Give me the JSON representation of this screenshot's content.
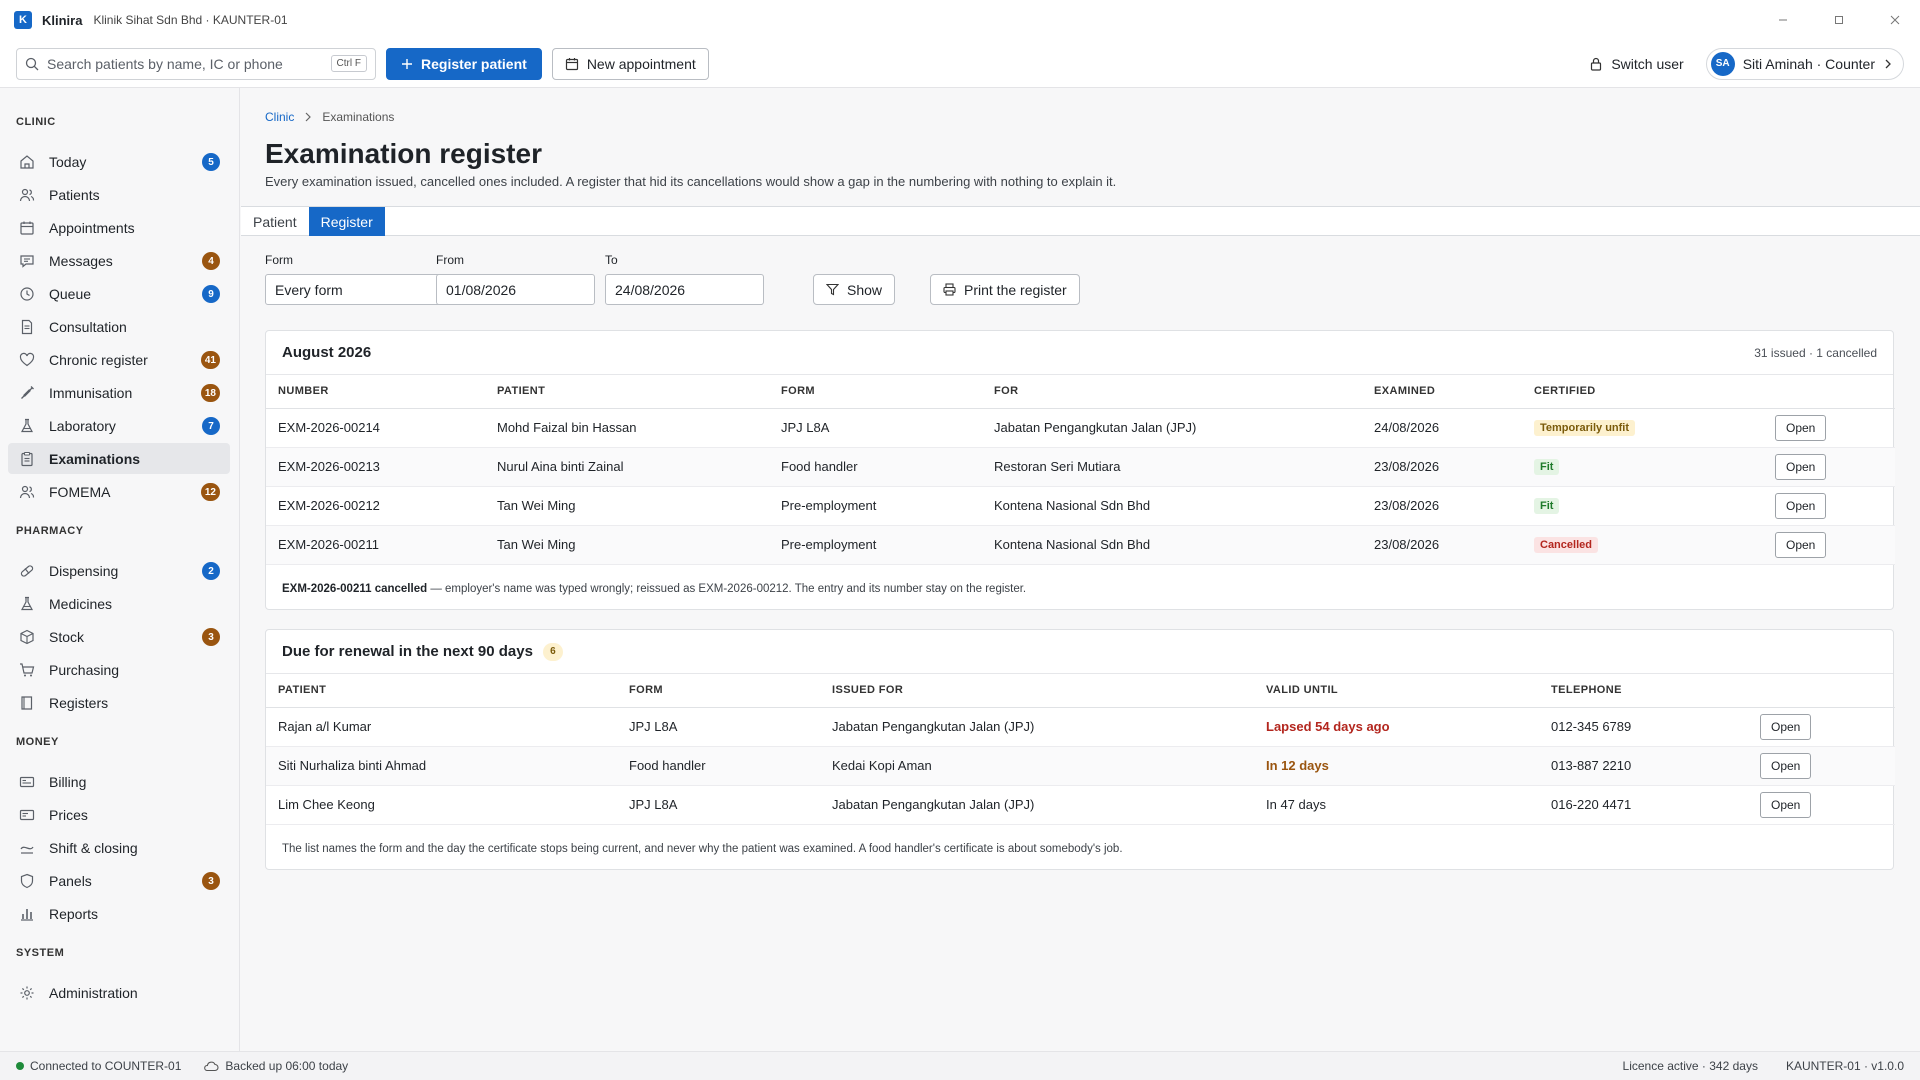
{
  "titlebar": {
    "logo_letter": "K",
    "app_name": "Klinira",
    "subtitle": "Klinik Sihat Sdn Bhd · KAUNTER-01"
  },
  "toolbar": {
    "search_placeholder": "Search patients by name, IC or phone",
    "search_shortcut": "Ctrl F",
    "register_patient": "Register patient",
    "new_appointment": "New appointment",
    "switch_user": "Switch user",
    "user_initials": "SA",
    "user_label": "Siti Aminah · Counter"
  },
  "sidebar": {
    "clinic_head": "CLINIC",
    "clinic": [
      {
        "label": "Today",
        "badge": "5",
        "icon": "home-icon"
      },
      {
        "label": "Patients",
        "badge": "",
        "icon": "users-icon"
      },
      {
        "label": "Appointments",
        "badge": "",
        "icon": "calendar-icon"
      },
      {
        "label": "Messages",
        "badge": "4",
        "icon": "message-icon"
      },
      {
        "label": "Queue",
        "badge": "9",
        "icon": "clock-icon"
      },
      {
        "label": "Consultation",
        "badge": "",
        "icon": "document-icon"
      },
      {
        "label": "Chronic register",
        "badge": "41",
        "icon": "heart-icon"
      },
      {
        "label": "Immunisation",
        "badge": "18",
        "icon": "syringe-icon"
      },
      {
        "label": "Laboratory",
        "badge": "7",
        "icon": "flask-icon"
      },
      {
        "label": "Examinations",
        "badge": "",
        "icon": "clipboard-icon"
      },
      {
        "label": "FOMEMA",
        "badge": "12",
        "icon": "users-icon"
      }
    ],
    "pharmacy_head": "PHARMACY",
    "pharmacy": [
      {
        "label": "Dispensing",
        "badge": "2",
        "icon": "pill-icon"
      },
      {
        "label": "Medicines",
        "badge": "",
        "icon": "flask-icon"
      },
      {
        "label": "Stock",
        "badge": "3",
        "icon": "box-icon"
      },
      {
        "label": "Purchasing",
        "badge": "",
        "icon": "cart-icon"
      },
      {
        "label": "Registers",
        "badge": "",
        "icon": "book-icon"
      }
    ],
    "money_head": "MONEY",
    "money": [
      {
        "label": "Billing",
        "badge": "",
        "icon": "billing-icon"
      },
      {
        "label": "Prices",
        "badge": "",
        "icon": "tag-icon"
      },
      {
        "label": "Shift & closing",
        "badge": "",
        "icon": "cash-icon"
      },
      {
        "label": "Panels",
        "badge": "3",
        "icon": "shield-icon"
      },
      {
        "label": "Reports",
        "badge": "",
        "icon": "chart-icon"
      }
    ],
    "system_head": "SYSTEM",
    "system": [
      {
        "label": "Administration",
        "badge": "",
        "icon": "gear-icon"
      }
    ]
  },
  "main": {
    "breadcrumb_root": "Clinic",
    "breadcrumb_current": "Examinations",
    "title": "Examination register",
    "description": "Every examination issued, cancelled ones included. A register that hid its cancellations would show a gap in the numbering with nothing to explain it.",
    "tabs": [
      "Patient",
      "Register"
    ],
    "filters": {
      "form_label": "Form",
      "form_value": "Every form",
      "from_label": "From",
      "from_value": "01/08/2026",
      "to_label": "To",
      "to_value": "24/08/2026",
      "show": "Show",
      "print": "Print the register"
    },
    "register": {
      "title": "August 2026",
      "meta": "31 issued · 1 cancelled",
      "headers": [
        "NUMBER",
        "PATIENT",
        "FORM",
        "FOR",
        "EXAMINED",
        "CERTIFIED"
      ],
      "open_label": "Open",
      "rows": [
        {
          "number": "EXM-2026-00214",
          "patient": "Mohd Faizal bin Hassan",
          "form": "JPJ L8A",
          "for": "Jabatan Pengangkutan Jalan (JPJ)",
          "examined": "24/08/2026",
          "certified": "Temporarily unfit",
          "status": "amber"
        },
        {
          "number": "EXM-2026-00213",
          "patient": "Nurul Aina binti Zainal",
          "form": "Food handler",
          "for": "Restoran Seri Mutiara",
          "examined": "23/08/2026",
          "certified": "Fit",
          "status": "green"
        },
        {
          "number": "EXM-2026-00212",
          "patient": "Tan Wei Ming",
          "form": "Pre-employment",
          "for": "Kontena Nasional Sdn Bhd",
          "examined": "23/08/2026",
          "certified": "Fit",
          "status": "green"
        },
        {
          "number": "EXM-2026-00211",
          "patient": "Tan Wei Ming",
          "form": "Pre-employment",
          "for": "Kontena Nasional Sdn Bhd",
          "examined": "23/08/2026",
          "certified": "Cancelled",
          "status": "red"
        }
      ],
      "note_bold": "EXM-2026-00211 cancelled",
      "note_rest": " — employer's name was typed wrongly; reissued as EXM-2026-00212. The entry and its number stay on the register."
    },
    "renewals": {
      "title": "Due for renewal in the next 90 days",
      "count": "6",
      "headers": [
        "PATIENT",
        "FORM",
        "ISSUED FOR",
        "VALID UNTIL",
        "TELEPHONE"
      ],
      "rows": [
        {
          "patient": "Rajan a/l Kumar",
          "form": "JPJ L8A",
          "issued_for": "Jabatan Pengangkutan Jalan (JPJ)",
          "valid_until": "Lapsed 54 days ago",
          "tone": "red",
          "telephone": "012-345 6789"
        },
        {
          "patient": "Siti Nurhaliza binti Ahmad",
          "form": "Food handler",
          "issued_for": "Kedai Kopi Aman",
          "valid_until": "In 12 days",
          "tone": "amber",
          "telephone": "013-887 2210"
        },
        {
          "patient": "Lim Chee Keong",
          "form": "JPJ L8A",
          "issued_for": "Jabatan Pengangkutan Jalan (JPJ)",
          "valid_until": "In 47 days",
          "tone": "plain",
          "telephone": "016-220 4471"
        }
      ],
      "note": "The list names the form and the day the certificate stops being current, and never why the patient was examined. A food handler's certificate is about somebody's job."
    }
  },
  "statusbar": {
    "connection": "Connected to COUNTER-01",
    "backup": "Backed up 06:00 today",
    "licence": "Licence active · 342 days",
    "version": "KAUNTER-01 · v1.0.0"
  },
  "colors": {
    "accent": "#1668c7",
    "badge_amber": "#9a5510",
    "status_green": "#1e8a3a",
    "danger": "#b3261e"
  }
}
